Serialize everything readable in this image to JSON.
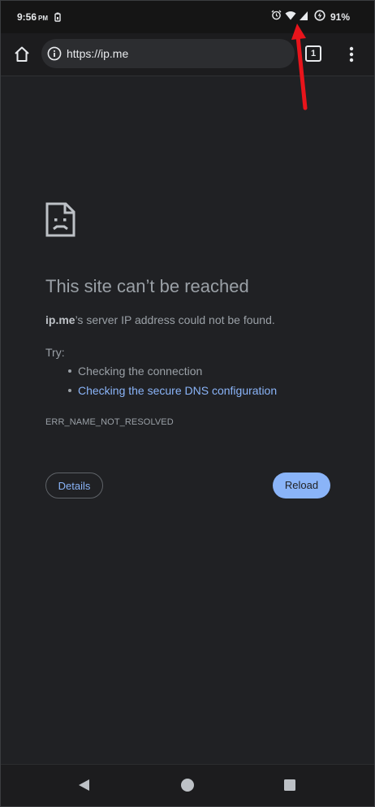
{
  "status_bar": {
    "time": "9:56",
    "ampm": "PM",
    "battery": "91%",
    "icons": [
      "battery-saver-icon",
      "alarm-icon",
      "wifi-icon",
      "cell-signal-icon",
      "battery-charging-icon"
    ]
  },
  "toolbar": {
    "url": "https://ip.me",
    "tab_count": "1",
    "icons": [
      "home-icon",
      "info-icon",
      "more-vert-icon"
    ]
  },
  "error_page": {
    "title": "This site can’t be reached",
    "host": "ip.me",
    "description_rest": "’s server IP address could not be found.",
    "try_label": "Try:",
    "suggestions": [
      {
        "text": "Checking the connection"
      },
      {
        "text": "Checking the secure DNS configuration"
      }
    ],
    "error_code": "ERR_NAME_NOT_RESOLVED",
    "details_label": "Details",
    "reload_label": "Reload"
  },
  "nav_bar": {
    "icons": [
      "back-icon",
      "home-circle-icon",
      "recents-icon"
    ]
  },
  "colors": {
    "link": "#8ab4f8",
    "text": "#9aa0a6",
    "background": "#202124",
    "annotation": "#e8141b"
  }
}
